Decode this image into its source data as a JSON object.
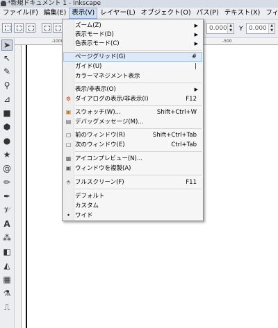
{
  "window": {
    "title": "*新規ドキュメント 1 - Inkscape"
  },
  "menubar": [
    "ファイル(F)",
    "編集(E)",
    "表示(V)",
    "レイヤー(L)",
    "オブジェクト(O)",
    "パス(P)",
    "テキスト(X)",
    "フィルター(S)"
  ],
  "toolbar": {
    "x_value": "0.000",
    "y_value": "0.000",
    "y_label": "Y"
  },
  "ruler": {
    "tick_a": "-1000",
    "tick_b": "-500"
  },
  "view_menu": {
    "zoom": "ズーム(Z)",
    "display_mode": "表示モード(D)",
    "color_display_mode": "色表示モード(C)",
    "page_grid": "ページグリッド(G)",
    "page_grid_shortcut": "#",
    "guides": "ガイド(U)",
    "guides_shortcut": "|",
    "color_management": "カラーマネジメント表示",
    "show_hide": "表示/非表示(O)",
    "show_hide_dialogs": "ダイアログの表示/非表示(I)",
    "show_hide_dialogs_shortcut": "F12",
    "swatches": "スウォッチ(W)...",
    "swatches_shortcut": "Shift+Ctrl+W",
    "debug_messages": "デバッグメッセージ(M)...",
    "prev_window": "前のウィンドウ(R)",
    "prev_window_shortcut": "Shift+Ctrl+Tab",
    "next_window": "次のウィンドウ(E)",
    "next_window_shortcut": "Ctrl+Tab",
    "icon_preview": "アイコンプレビュー(N)...",
    "duplicate_window": "ウィンドウを複製(A)",
    "fullscreen": "フルスクリーン(F)",
    "fullscreen_shortcut": "F11",
    "default": "デフォルト",
    "custom": "カスタム",
    "wide": "ワイド",
    "wide_bullet": "•"
  }
}
